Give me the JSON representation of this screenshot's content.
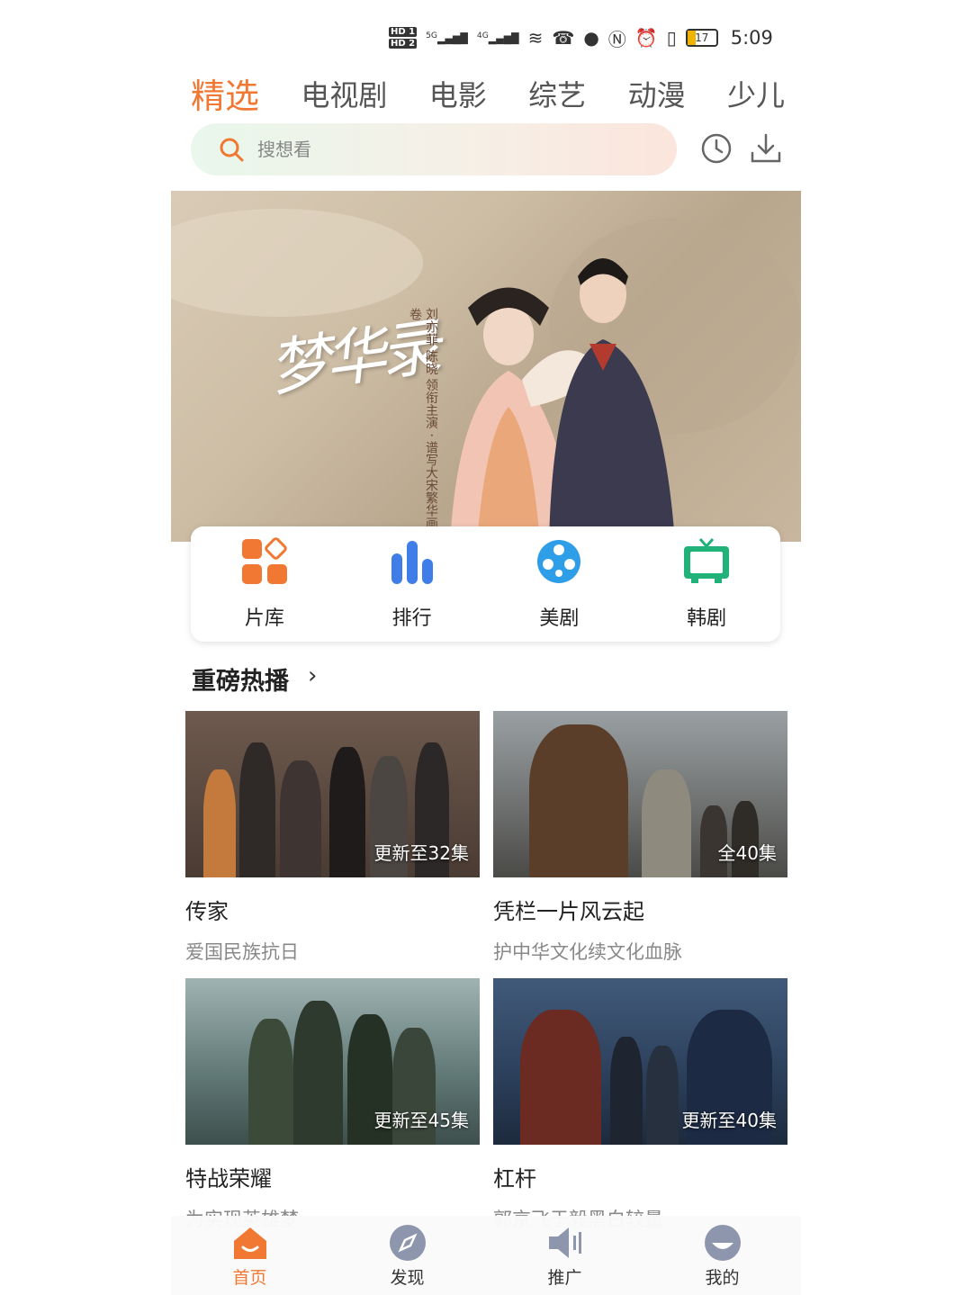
{
  "status_bar": {
    "hd1": "HD 1",
    "hd2": "HD 2",
    "net1": "5G",
    "net2": "4G",
    "battery": "17",
    "time": "5:09"
  },
  "tabs": [
    {
      "label": "精选",
      "active": true
    },
    {
      "label": "电视剧",
      "active": false
    },
    {
      "label": "电影",
      "active": false
    },
    {
      "label": "综艺",
      "active": false
    },
    {
      "label": "动漫",
      "active": false
    },
    {
      "label": "少儿",
      "active": false
    }
  ],
  "search": {
    "placeholder": "搜想看"
  },
  "header_icons": {
    "history": "clock-icon",
    "download": "download-icon"
  },
  "banner": {
    "title": "梦华录",
    "subtitle": "刘亦菲 陈晓 领衔主演 · 谱写大宋繁华画卷"
  },
  "categories": [
    {
      "label": "片库",
      "icon": "library-icon",
      "color": "#f07833"
    },
    {
      "label": "排行",
      "icon": "ranking-icon",
      "color": "#3f7ee8"
    },
    {
      "label": "美剧",
      "icon": "film-reel-icon",
      "color": "#2f9ee8"
    },
    {
      "label": "韩剧",
      "icon": "tv-icon",
      "color": "#21b27a"
    }
  ],
  "section": {
    "title": "重磅热播",
    "more": "›"
  },
  "cards": [
    {
      "title": "传家",
      "subtitle": "爱国民族抗日",
      "badge": "更新至32集"
    },
    {
      "title": "凭栏一片风云起",
      "subtitle": "护中华文化续文化血脉",
      "badge": "全40集"
    },
    {
      "title": "特战荣耀",
      "subtitle": "为实现英雄梦",
      "badge": "更新至45集"
    },
    {
      "title": "杠杆",
      "subtitle": "郭京飞于毅黑白较量",
      "badge": "更新至40集"
    }
  ],
  "bottom_nav": [
    {
      "label": "首页",
      "icon": "home-icon",
      "active": true
    },
    {
      "label": "发现",
      "icon": "compass-icon",
      "active": false
    },
    {
      "label": "推广",
      "icon": "speaker-icon",
      "active": false
    },
    {
      "label": "我的",
      "icon": "profile-icon",
      "active": false
    }
  ],
  "colors": {
    "accent": "#f07833",
    "text": "#222222",
    "muted": "#888888"
  }
}
